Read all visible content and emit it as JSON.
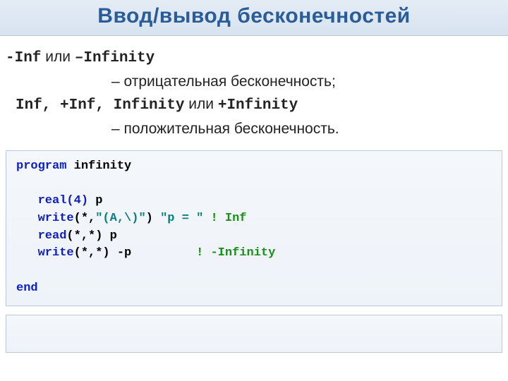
{
  "title": "Ввод/вывод бесконечностей",
  "line1": {
    "code1": "-Inf",
    "mid": " или ",
    "code2": "–Infinity"
  },
  "line2": "– отрицательная бесконечность;",
  "line3": {
    "code": "Inf, +Inf, Infinity",
    "mid": " или ",
    "code2": "+Infinity"
  },
  "line4": "– положительная бесконечность.",
  "code": {
    "l1a": "program",
    "l1b": " infinity",
    "l2a": "   real(4)",
    "l2b": " p",
    "l3a": "   write",
    "l3b": "(*,",
    "l3c": "\"(A,\\)\"",
    "l3d": ") ",
    "l3e": "\"p = \"",
    "l3f": " ! Inf",
    "l4a": "   read",
    "l4b": "(*,*) p",
    "l5a": "   write",
    "l5b": "(*,*) -p         ",
    "l5c": "! -Infinity",
    "l6": "end"
  }
}
